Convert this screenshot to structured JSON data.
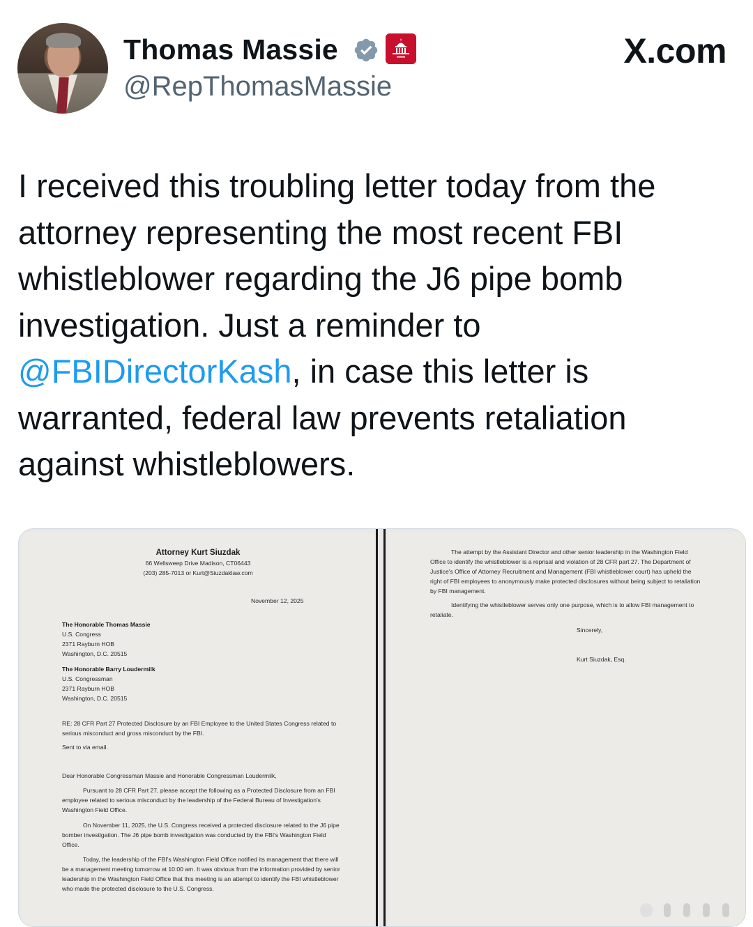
{
  "author": {
    "name": "Thomas Massie",
    "handle": "@RepThomasMassie"
  },
  "site_label": "X.com",
  "tweet": {
    "text_before": "I received this troubling letter today from the attorney representing the most recent FBI whistleblower regarding the J6 pipe bomb investigation. Just a reminder to ",
    "mention": "@FBIDirectorKash",
    "text_after": ", in case this letter is warranted, federal law prevents retaliation against whistleblowers."
  },
  "letter_page1": {
    "sender_name": "Attorney Kurt Siuzdak",
    "sender_address": "66 Wellsweep Drive Madison, CT06443",
    "sender_contact": "(203) 285-7013 or Kurt@Siuzdaklaw.com",
    "date": "November 12, 2025",
    "recipient1": {
      "name": "The Honorable Thomas Massie",
      "line1": "U.S. Congress",
      "line2": "2371 Rayburn HOB",
      "line3": "Washington, D.C. 20515"
    },
    "recipient2": {
      "name": "The Honorable Barry Loudermilk",
      "line1": "U.S. Congressman",
      "line2": "2371 Rayburn HOB",
      "line3": "Washington, D.C. 20515"
    },
    "re_line": "RE: 28 CFR Part 27 Protected Disclosure by an FBI Employee to the United States Congress related to serious misconduct and gross misconduct by the FBI.",
    "sent_via": "Sent to via email.",
    "salutation": "Dear Honorable Congressman Massie and Honorable Congressman Loudermilk,",
    "para1": "Pursuant to 28 CFR Part 27, please accept the following as a Protected Disclosure from an FBI employee related to serious misconduct by the leadership of the Federal Bureau of Investigation's Washington Field Office.",
    "para2": "On November 11, 2025, the U.S. Congress received a protected disclosure related to the J6 pipe bomber investigation. The J6 pipe bomb investigation was conducted by the FBI's Washington Field Office.",
    "para3": "Today, the leadership of the FBI's Washington Field Office notified its management that there will be a management meeting tomorrow at 10:00 am. It was obvious from the information provided by senior leadership in the Washington Field Office that this meeting is an attempt to identify the FBI whistleblower who made the protected disclosure to the U.S. Congress."
  },
  "letter_page2": {
    "para1": "The attempt by the Assistant Director and other senior leadership in the Washington Field Office to identify the whistleblower is a reprisal and violation of 28 CFR part 27. The Department of Justice's Office of Attorney Recruitment and Management (FBI whistleblower court) has upheld the right of FBI employees to anonymously make protected disclosures without being subject to retaliation by FBI management.",
    "para2": "Identifying the whistleblower serves only one purpose, which is to allow FBI management to retaliate.",
    "closing": "Sincerely,",
    "signature": "Kurt Siuzdak, Esq."
  },
  "colors": {
    "text": "#0f1419",
    "secondary": "#536471",
    "link": "#1d9bf0",
    "verified": "#829aab",
    "badge": "#c8102e"
  }
}
